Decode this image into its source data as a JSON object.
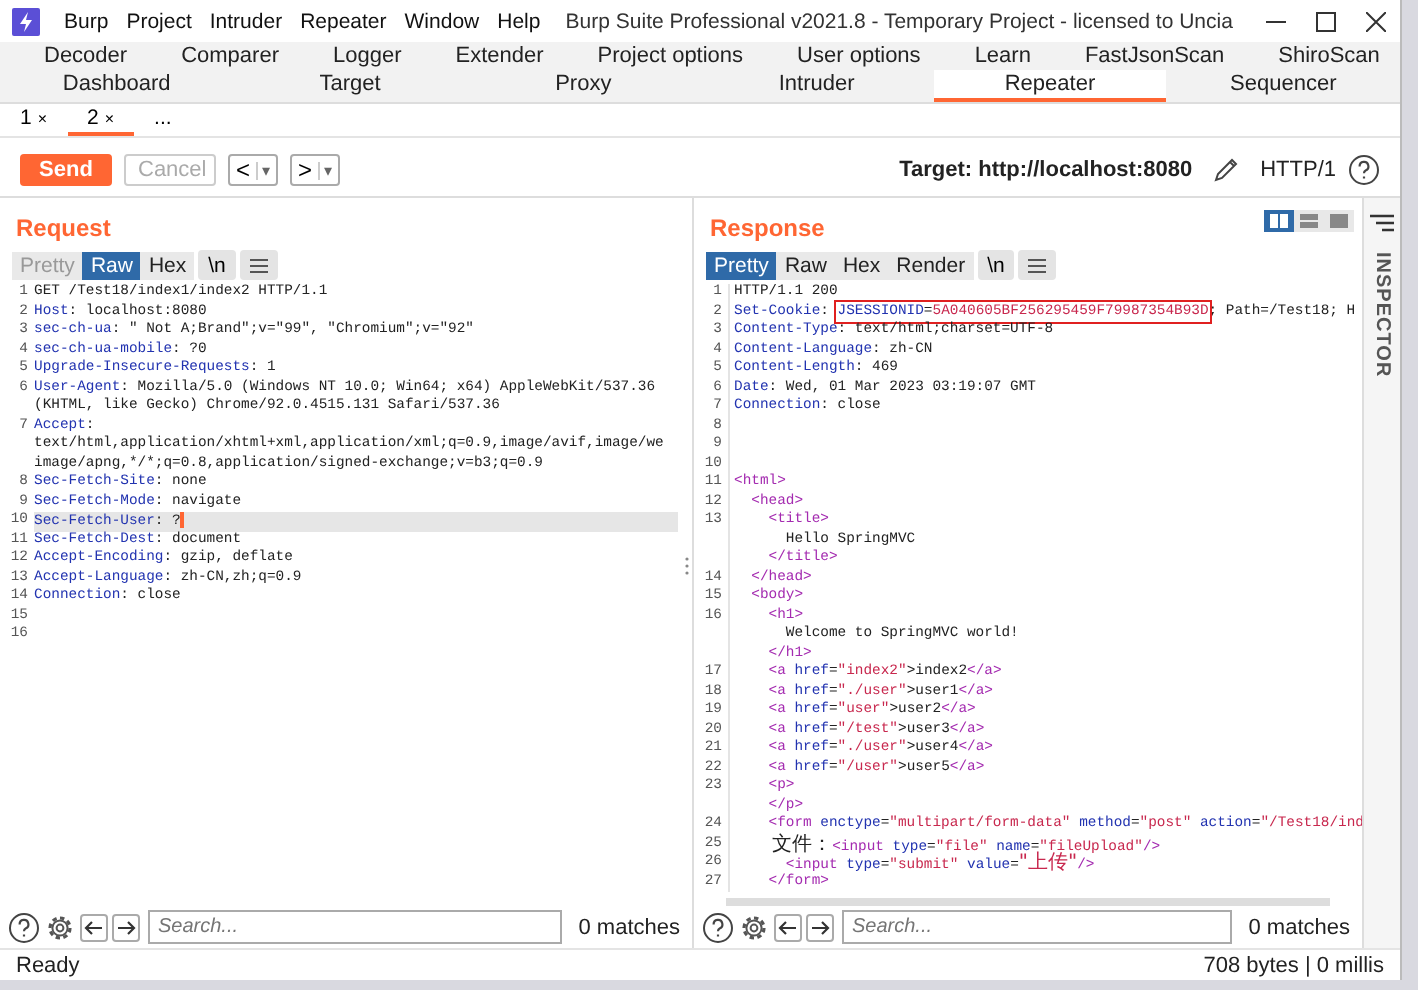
{
  "window": {
    "title": "Burp Suite Professional v2021.8 - Temporary Project - licensed to Uncia"
  },
  "menu": [
    "Burp",
    "Project",
    "Intruder",
    "Repeater",
    "Window",
    "Help"
  ],
  "tools_row_1": [
    {
      "label": "Decoder",
      "selected": false
    },
    {
      "label": "Comparer",
      "selected": false
    },
    {
      "label": "Logger",
      "selected": false
    },
    {
      "label": "Extender",
      "selected": false
    },
    {
      "label": "Project options",
      "selected": false
    },
    {
      "label": "User options",
      "selected": false
    },
    {
      "label": "Learn",
      "selected": false
    },
    {
      "label": "FastJsonScan",
      "selected": false
    },
    {
      "label": "ShiroScan",
      "selected": false
    }
  ],
  "tools_row_2": [
    {
      "label": "Dashboard",
      "selected": false
    },
    {
      "label": "Target",
      "selected": false
    },
    {
      "label": "Proxy",
      "selected": false
    },
    {
      "label": "Intruder",
      "selected": false
    },
    {
      "label": "Repeater",
      "selected": true
    },
    {
      "label": "Sequencer",
      "selected": false
    }
  ],
  "repeater_tabs": [
    {
      "label": "1",
      "close": "×",
      "selected": false
    },
    {
      "label": "2",
      "close": "×",
      "selected": true
    },
    {
      "label": "...",
      "selected": false
    }
  ],
  "toolbar": {
    "send": "Send",
    "cancel": {
      "label": "Cancel",
      "disabled": true
    },
    "nav": [
      {
        "label": "<",
        "menu": "▾"
      },
      {
        "label": ">",
        "menu": "▾"
      }
    ],
    "target": "Target: http://localhost:8080",
    "protocol": "HTTP/1"
  },
  "request": {
    "title": "Request",
    "views": [
      {
        "label": "Pretty",
        "selected": false,
        "disabled": true
      },
      {
        "label": "Raw",
        "selected": true,
        "disabled": false
      },
      {
        "label": "Hex",
        "selected": false,
        "disabled": false
      }
    ],
    "newline": "\\n",
    "lines": [
      {
        "num": "1",
        "segments": [
          {
            "text": "GET /Test18/index1/index2 HTTP/1.1",
            "kind": "plain"
          }
        ]
      },
      {
        "num": "2",
        "segments": [
          {
            "text": "Host",
            "kind": "key"
          },
          {
            "text": ": localhost:8080",
            "kind": "plain"
          }
        ]
      },
      {
        "num": "3",
        "segments": [
          {
            "text": "sec-ch-ua",
            "kind": "key"
          },
          {
            "text": ": \" Not A;Brand\";v=\"99\", \"Chromium\";v=\"92\"",
            "kind": "plain"
          }
        ]
      },
      {
        "num": "4",
        "segments": [
          {
            "text": "sec-ch-ua-mobile",
            "kind": "key"
          },
          {
            "text": ": ?0",
            "kind": "plain"
          }
        ]
      },
      {
        "num": "5",
        "segments": [
          {
            "text": "Upgrade-Insecure-Requests",
            "kind": "key"
          },
          {
            "text": ": 1",
            "kind": "plain"
          }
        ]
      },
      {
        "num": "6",
        "segments": [
          {
            "text": "User-Agent",
            "kind": "key"
          },
          {
            "text": ": Mozilla/5.0 (Windows NT 10.0; Win64; x64) AppleWebKit/537.36",
            "kind": "plain"
          }
        ]
      },
      {
        "segments": [
          {
            "text": "(KHTML, like Gecko) Chrome/92.0.4515.131 Safari/537.36",
            "kind": "plain"
          }
        ]
      },
      {
        "num": "7",
        "segments": [
          {
            "text": "Accept",
            "kind": "key"
          },
          {
            "text": ":",
            "kind": "plain"
          }
        ]
      },
      {
        "segments": [
          {
            "text": "text/html,application/xhtml+xml,application/xml;q=0.9,image/avif,image/we",
            "kind": "plain"
          }
        ]
      },
      {
        "segments": [
          {
            "text": "image/apng,*/*;q=0.8,application/signed-exchange;v=b3;q=0.9",
            "kind": "plain"
          }
        ]
      },
      {
        "num": "8",
        "segments": [
          {
            "text": "Sec-Fetch-Site",
            "kind": "key"
          },
          {
            "text": ": none",
            "kind": "plain"
          }
        ]
      },
      {
        "num": "9",
        "segments": [
          {
            "text": "Sec-Fetch-Mode",
            "kind": "key"
          },
          {
            "text": ": navigate",
            "kind": "plain"
          }
        ]
      },
      {
        "num": "10",
        "current": true,
        "segments": [
          {
            "text": "Sec-Fetch-User",
            "kind": "key"
          },
          {
            "text": ": ?",
            "kind": "plain"
          }
        ]
      },
      {
        "num": "11",
        "segments": [
          {
            "text": "Sec-Fetch-Dest",
            "kind": "key"
          },
          {
            "text": ": document",
            "kind": "plain"
          }
        ]
      },
      {
        "num": "12",
        "segments": [
          {
            "text": "Accept-Encoding",
            "kind": "key"
          },
          {
            "text": ": gzip, deflate",
            "kind": "plain"
          }
        ]
      },
      {
        "num": "13",
        "segments": [
          {
            "text": "Accept-Language",
            "kind": "key"
          },
          {
            "text": ": zh-CN,zh;q=0.9",
            "kind": "plain"
          }
        ]
      },
      {
        "num": "14",
        "segments": [
          {
            "text": "Connection",
            "kind": "key"
          },
          {
            "text": ": close",
            "kind": "plain"
          }
        ]
      },
      {
        "num": "15"
      },
      {
        "num": "16"
      }
    ],
    "search": {
      "placeholder": "Search...",
      "matches": "0 matches"
    }
  },
  "response": {
    "title": "Response",
    "views": [
      {
        "label": "Pretty",
        "selected": true,
        "disabled": false
      },
      {
        "label": "Raw",
        "selected": false,
        "disabled": false
      },
      {
        "label": "Hex",
        "selected": false,
        "disabled": false
      },
      {
        "label": "Render",
        "selected": false,
        "disabled": false
      }
    ],
    "newline": "\\n",
    "layouts": [
      {
        "selected": true
      },
      {
        "selected": false
      },
      {
        "selected": false
      }
    ],
    "lines": [
      {
        "num": "1",
        "segments": [
          {
            "text": "HTTP/1.1 200",
            "kind": "plain"
          }
        ]
      },
      {
        "num": "2",
        "segments": [
          {
            "text": "Set-Cookie",
            "kind": "key"
          },
          {
            "text": ": ",
            "kind": "plain"
          },
          {
            "kind": "boxed",
            "segments": [
              {
                "text": "JSESSIONID",
                "kind": "key"
              },
              {
                "text": "=",
                "kind": "plain"
              },
              {
                "text": "5A040605BF256295459F79987354B93D",
                "kind": "str"
              }
            ]
          },
          {
            "text": "; Path=/Test18; H",
            "kind": "plain"
          }
        ]
      },
      {
        "num": "3",
        "segments": [
          {
            "text": "Content-Type",
            "kind": "key"
          },
          {
            "text": ": text/html;charset=UTF-8",
            "kind": "plain"
          }
        ]
      },
      {
        "num": "4",
        "segments": [
          {
            "text": "Content-Language",
            "kind": "key"
          },
          {
            "text": ": zh-CN",
            "kind": "plain"
          }
        ]
      },
      {
        "num": "5",
        "segments": [
          {
            "text": "Content-Length",
            "kind": "key"
          },
          {
            "text": ": 469",
            "kind": "plain"
          }
        ]
      },
      {
        "num": "6",
        "segments": [
          {
            "text": "Date",
            "kind": "key"
          },
          {
            "text": ": Wed, 01 Mar 2023 03:19:07 GMT",
            "kind": "plain"
          }
        ]
      },
      {
        "num": "7",
        "segments": [
          {
            "text": "Connection",
            "kind": "key"
          },
          {
            "text": ": close",
            "kind": "plain"
          }
        ]
      },
      {
        "num": "8"
      },
      {
        "num": "9"
      },
      {
        "num": "10"
      },
      {
        "num": "11",
        "segments": [
          {
            "text": "<html>",
            "kind": "tag"
          }
        ]
      },
      {
        "num": "12",
        "segments": [
          {
            "text": "  <head>",
            "kind": "tag"
          }
        ]
      },
      {
        "num": "13",
        "segments": [
          {
            "text": "    <title>",
            "kind": "tag"
          }
        ]
      },
      {
        "segments": [
          {
            "text": "      Hello SpringMVC",
            "kind": "plain"
          }
        ]
      },
      {
        "segments": [
          {
            "text": "    </title>",
            "kind": "tag"
          }
        ]
      },
      {
        "num": "14",
        "segments": [
          {
            "text": "  </head>",
            "kind": "tag"
          }
        ]
      },
      {
        "num": "15",
        "segments": [
          {
            "text": "  <body>",
            "kind": "tag"
          }
        ]
      },
      {
        "num": "16",
        "segments": [
          {
            "text": "    <h1>",
            "kind": "tag"
          }
        ]
      },
      {
        "segments": [
          {
            "text": "      Welcome to SpringMVC world!",
            "kind": "plain"
          }
        ]
      },
      {
        "segments": [
          {
            "text": "    </h1>",
            "kind": "tag"
          }
        ]
      },
      {
        "num": "17",
        "segments": [
          {
            "text": "    <a ",
            "kind": "tag"
          },
          {
            "text": "href",
            "kind": "key"
          },
          {
            "text": "=",
            "kind": "plain"
          },
          {
            "text": "\"index2\"",
            "kind": "str"
          },
          {
            "text": ">index2",
            "kind": "plain"
          },
          {
            "text": "</a>",
            "kind": "tag"
          }
        ]
      },
      {
        "num": "18",
        "segments": [
          {
            "text": "    <a ",
            "kind": "tag"
          },
          {
            "text": "href",
            "kind": "key"
          },
          {
            "text": "=",
            "kind": "plain"
          },
          {
            "text": "\"./user\"",
            "kind": "str"
          },
          {
            "text": ">user1",
            "kind": "plain"
          },
          {
            "text": "</a>",
            "kind": "tag"
          }
        ]
      },
      {
        "num": "19",
        "segments": [
          {
            "text": "    <a ",
            "kind": "tag"
          },
          {
            "text": "href",
            "kind": "key"
          },
          {
            "text": "=",
            "kind": "plain"
          },
          {
            "text": "\"user\"",
            "kind": "str"
          },
          {
            "text": ">user2",
            "kind": "plain"
          },
          {
            "text": "</a>",
            "kind": "tag"
          }
        ]
      },
      {
        "num": "20",
        "segments": [
          {
            "text": "    <a ",
            "kind": "tag"
          },
          {
            "text": "href",
            "kind": "key"
          },
          {
            "text": "=",
            "kind": "plain"
          },
          {
            "text": "\"/test\"",
            "kind": "str"
          },
          {
            "text": ">user3",
            "kind": "plain"
          },
          {
            "text": "</a>",
            "kind": "tag"
          }
        ]
      },
      {
        "num": "21",
        "segments": [
          {
            "text": "    <a ",
            "kind": "tag"
          },
          {
            "text": "href",
            "kind": "key"
          },
          {
            "text": "=",
            "kind": "plain"
          },
          {
            "text": "\"./user\"",
            "kind": "str"
          },
          {
            "text": ">user4",
            "kind": "plain"
          },
          {
            "text": "</a>",
            "kind": "tag"
          }
        ]
      },
      {
        "num": "22",
        "segments": [
          {
            "text": "    <a ",
            "kind": "tag"
          },
          {
            "text": "href",
            "kind": "key"
          },
          {
            "text": "=",
            "kind": "plain"
          },
          {
            "text": "\"/user\"",
            "kind": "str"
          },
          {
            "text": ">user5",
            "kind": "plain"
          },
          {
            "text": "</a>",
            "kind": "tag"
          }
        ]
      },
      {
        "num": "23",
        "segments": [
          {
            "text": "    <p>",
            "kind": "tag"
          }
        ]
      },
      {
        "segments": [
          {
            "text": "    </p>",
            "kind": "tag"
          }
        ]
      },
      {
        "num": "24",
        "segments": [
          {
            "text": "    <form ",
            "kind": "tag"
          },
          {
            "text": "enctype",
            "kind": "key"
          },
          {
            "text": "=",
            "kind": "plain"
          },
          {
            "text": "\"multipart/form-data\" ",
            "kind": "str"
          },
          {
            "text": "method",
            "kind": "key"
          },
          {
            "text": "=",
            "kind": "plain"
          },
          {
            "text": "\"post\" ",
            "kind": "str"
          },
          {
            "text": "action",
            "kind": "key"
          },
          {
            "text": "=",
            "kind": "plain"
          },
          {
            "text": "\"/Test18/ind",
            "kind": "str"
          }
        ]
      },
      {
        "num": "25",
        "segments": [
          {
            "text": "      文件：",
            "kind": "plain",
            "cjk": true
          },
          {
            "text": "<input ",
            "kind": "tag"
          },
          {
            "text": "type",
            "kind": "key"
          },
          {
            "text": "=",
            "kind": "plain"
          },
          {
            "text": "\"file\" ",
            "kind": "str"
          },
          {
            "text": "name",
            "kind": "key"
          },
          {
            "text": "=",
            "kind": "plain"
          },
          {
            "text": "\"fileUpload\"",
            "kind": "str"
          },
          {
            "text": "/>",
            "kind": "tag"
          }
        ]
      },
      {
        "num": "26",
        "segments": [
          {
            "text": "      <input ",
            "kind": "tag"
          },
          {
            "text": "type",
            "kind": "key"
          },
          {
            "text": "=",
            "kind": "plain"
          },
          {
            "text": "\"submit\" ",
            "kind": "str"
          },
          {
            "text": "value",
            "kind": "key"
          },
          {
            "text": "=",
            "kind": "plain"
          },
          {
            "text": "\"上传\"",
            "kind": "str",
            "cjk": true
          },
          {
            "text": "/>",
            "kind": "tag"
          }
        ]
      },
      {
        "num": "27",
        "segments": [
          {
            "text": "    </form>",
            "kind": "tag"
          }
        ]
      }
    ],
    "search": {
      "placeholder": "Search...",
      "matches": "0 matches"
    }
  },
  "inspector": {
    "label": "INSPECTOR"
  },
  "status_bar": {
    "left": "Ready",
    "right": "708 bytes | 0 millis"
  }
}
